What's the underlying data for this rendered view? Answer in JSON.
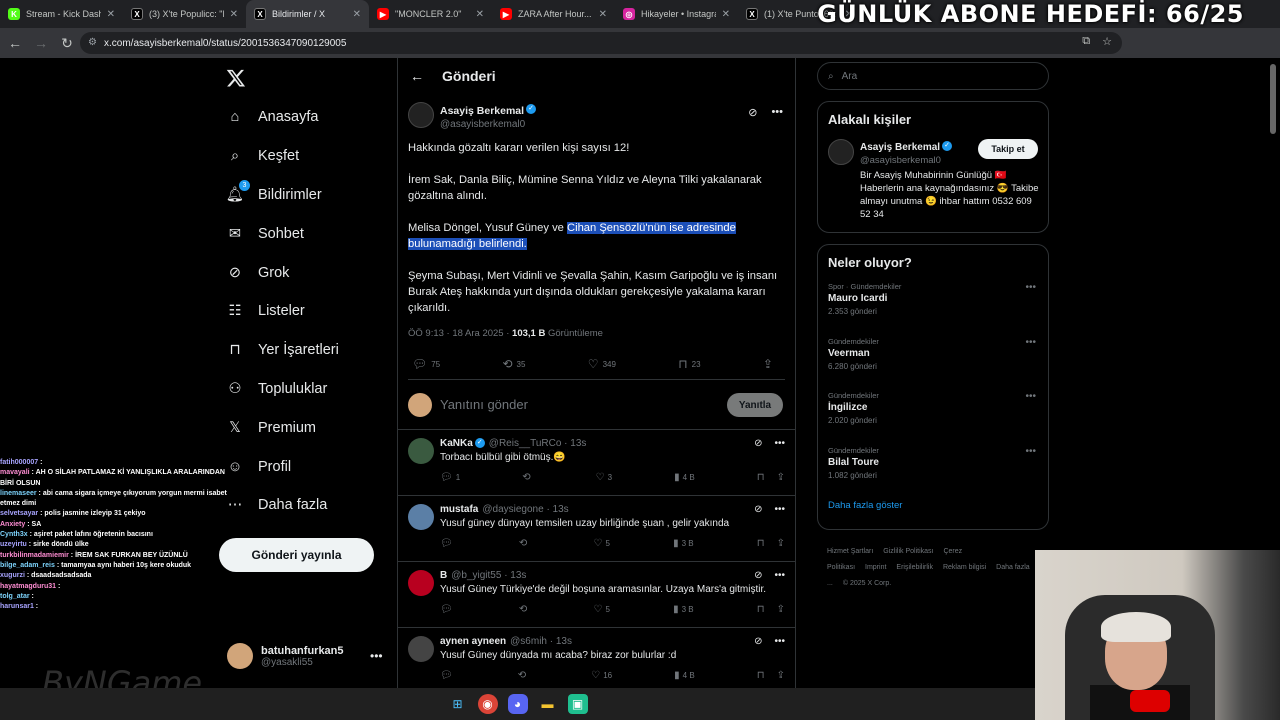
{
  "browser": {
    "tabs": [
      {
        "title": "Stream - Kick Dashb...",
        "fav": "K",
        "color": "#53fc18"
      },
      {
        "title": "(3) X'te Populicc: \"Rap",
        "fav": "X",
        "color": "#000000"
      },
      {
        "title": "Bildirimler / X",
        "fav": "X",
        "color": "#000000",
        "active": true
      },
      {
        "title": "\"MONCLER 2.0\"",
        "fav": "▶",
        "color": "#ff0000"
      },
      {
        "title": "ZARA After Hour...",
        "fav": "▶",
        "color": "#ff0000"
      },
      {
        "title": "Hikayeler • Instagram",
        "fav": "◎",
        "color": "#d6249f"
      },
      {
        "title": "(1) X'te Punto360: \"S",
        "fav": "X",
        "color": "#000000"
      }
    ],
    "url": "x.com/asayisberkemal0/status/2001536347090129005",
    "goal_overlay": "GÜNLÜK ABONE HEDEFİ: 66/25"
  },
  "sidebar": {
    "items": [
      {
        "label": "Anasayfa",
        "icon": "home-icon"
      },
      {
        "label": "Keşfet",
        "icon": "search-icon"
      },
      {
        "label": "Bildirimler",
        "icon": "bell-icon",
        "badge": "3"
      },
      {
        "label": "Sohbet",
        "icon": "mail-icon"
      },
      {
        "label": "Grok",
        "icon": "grok-icon"
      },
      {
        "label": "Listeler",
        "icon": "list-icon"
      },
      {
        "label": "Yer İşaretleri",
        "icon": "bookmark-icon"
      },
      {
        "label": "Topluluklar",
        "icon": "communities-icon"
      },
      {
        "label": "Premium",
        "icon": "x-logo-icon"
      },
      {
        "label": "Profil",
        "icon": "profile-icon"
      },
      {
        "label": "Daha fazla",
        "icon": "more-icon"
      }
    ],
    "post_button": "Gönderi yayınla",
    "account": {
      "name": "batuhanfurkan5",
      "handle": "@yasakli55"
    }
  },
  "main": {
    "header": "Gönderi",
    "tweet": {
      "name": "Asayiş Berkemal",
      "handle": "@asayisberkemal0",
      "p1": "Hakkında gözaltı kararı verilen kişi sayısı 12!",
      "p2": "İrem Sak, Danla Biliç, Mümine Senna Yıldız ve Aleyna Tilki yakalanarak gözaltına alındı.",
      "p3_plain": "Melisa Döngel, Yusuf Güney ve ",
      "p3_highlight": "Cihan Şensözlü'nün ise adresinde bulunamadığı belirlendi.",
      "p4": "Şeyma Subaşı, Mert Vidinli ve Şevalla Şahin, Kasım Garipoğlu ve iş insanı Burak Ateş hakkında yurt dışında oldukları gerekçesiyle yakalama kararı çıkarıldı.",
      "time": "ÖÖ 9:13 · 18 Ara 2025 · ",
      "views": "103,1 B",
      "views_label": " Görüntüleme",
      "stats": {
        "replies": "75",
        "reposts": "35",
        "likes": "349",
        "bookmarks": "23"
      }
    },
    "reply": {
      "placeholder": "Yanıtını gönder",
      "button": "Yanıtla"
    },
    "comments": [
      {
        "name": "KaNKa",
        "handle": "@Reis__TuRCo · 13s",
        "text": "Torbacı bülbül gibi ötmüş.😄",
        "replies": "1",
        "reposts": "",
        "likes": "3",
        "views": "4 B",
        "color": "#3a5a40",
        "verified": true
      },
      {
        "name": "mustafa",
        "handle": "@daysiegone · 13s",
        "text": "Yusuf güney dünyayı temsilen uzay birliğinde şuan , gelir yakında",
        "replies": "",
        "reposts": "",
        "likes": "5",
        "views": "3 B",
        "color": "#5b7fa6",
        "verified": false
      },
      {
        "name": "B",
        "handle": "@b_yigit55 · 13s",
        "text": "Yusuf Güney Türkiye'de değil boşuna aramasınlar. Uzaya Mars'a gitmiştir.",
        "replies": "",
        "reposts": "",
        "likes": "5",
        "views": "3 B",
        "color": "#b8001f",
        "verified": false
      },
      {
        "name": "aynen ayneen",
        "handle": "@s6mih · 13s",
        "text": "Yusuf Güney dünyada mı acaba? biraz zor bulurlar :d",
        "replies": "",
        "reposts": "",
        "likes": "16",
        "views": "4 B",
        "color": "#444444",
        "verified": false
      }
    ]
  },
  "right": {
    "search_placeholder": "Ara",
    "related": {
      "title": "Alakalı kişiler",
      "name": "Asayiş Berkemal",
      "handle": "@asayisberkemal0",
      "bio": "Bir Asayiş Muhabirinin Günlüğü 🇹🇷 Haberlerin ana kaynağındasınız 😎 Takibe almayı unutma 😉 ihbar hattım 0532 609 52 34",
      "follow": "Takip et"
    },
    "trends_title": "Neler oluyor?",
    "trends": [
      {
        "cat": "Spor · Gündemdekiler",
        "name": "Mauro Icardi",
        "count": "2.353 gönderi"
      },
      {
        "cat": "Gündemdekiler",
        "name": "Veerman",
        "count": "6.280 gönderi"
      },
      {
        "cat": "Gündemdekiler",
        "name": "İngilizce",
        "count": "2.020 gönderi"
      },
      {
        "cat": "Gündemdekiler",
        "name": "Bilal Toure",
        "count": "1.082 gönderi"
      }
    ],
    "show_more": "Daha fazla göster",
    "footer": [
      "Hizmet Şartları",
      "Gizlilik Politikası",
      "Çerez Politikası",
      "Imprint",
      "Erişilebilirlik",
      "Reklam bilgisi",
      "Daha fazla ...",
      "© 2025 X Corp."
    ]
  },
  "chat": [
    {
      "user": "fatih000007",
      "msg": ""
    },
    {
      "user": "mavayali",
      "msg": "AH O SİLAH PATLAMAZ Kİ YANLIŞLIKLA ARALARINDAN BİRİ OLSUN"
    },
    {
      "user": "linemaseer",
      "msg": "abi cama sigara içmeye çıkıyorum yorgun mermi isabet etmez dimi"
    },
    {
      "user": "selvetsayar",
      "msg": "polis jasmine izleyip 31 çekiyo"
    },
    {
      "user": "Anxiety",
      "msg": "SA"
    },
    {
      "user": "Cynth3x",
      "msg": "aşiret paket lafını öğretenin bacısını"
    },
    {
      "user": "uzeyirtu",
      "msg": "sirke döndü ülke"
    },
    {
      "user": "turkbilinmadamiemir",
      "msg": "İREM SAK FURKAN BEY ÜZÜNLÜ"
    },
    {
      "user": "bilge_adam_reis",
      "msg": "tamamyaa aynı haberi 10ş kere okuduk"
    },
    {
      "user": "xugurzi",
      "msg": "dsaadsadsadsada"
    },
    {
      "user": "hayatmagduru31",
      "msg": ""
    },
    {
      "user": "tolg_atar",
      "msg": ""
    },
    {
      "user": "harunsar1",
      "msg": ""
    }
  ],
  "watermark": "ByNGame",
  "colors": {
    "accent": "#1d9bf0",
    "highlight": "#1c4fb8",
    "border": "#2f3336",
    "muted": "#71767b"
  }
}
